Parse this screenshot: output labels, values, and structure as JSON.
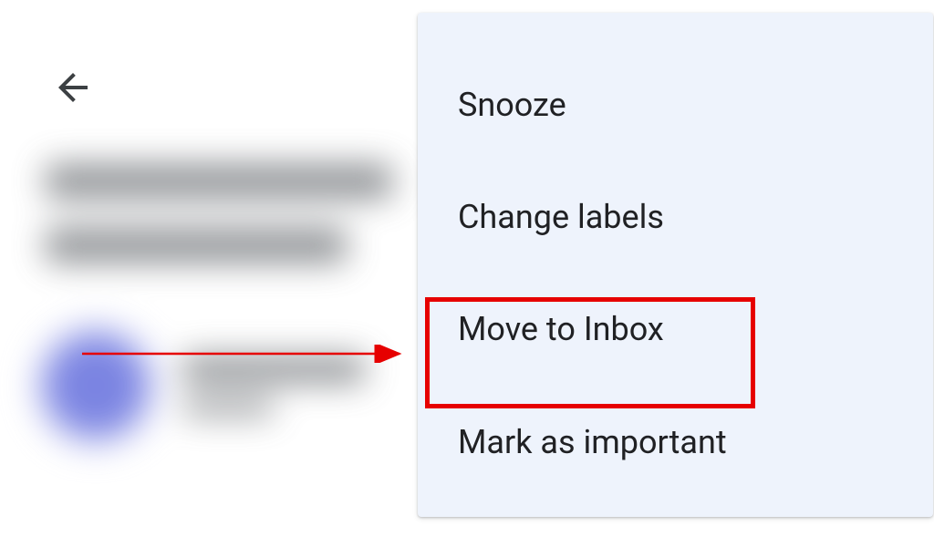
{
  "menu": {
    "items": [
      {
        "label": "Snooze"
      },
      {
        "label": "Change labels"
      },
      {
        "label": "Move to Inbox"
      },
      {
        "label": "Mark as important"
      }
    ]
  },
  "annotation": {
    "highlighted_item_index": 2,
    "arrow_color": "#e60000",
    "highlight_color": "#e60000"
  },
  "icons": {
    "back": "back-arrow-icon"
  }
}
